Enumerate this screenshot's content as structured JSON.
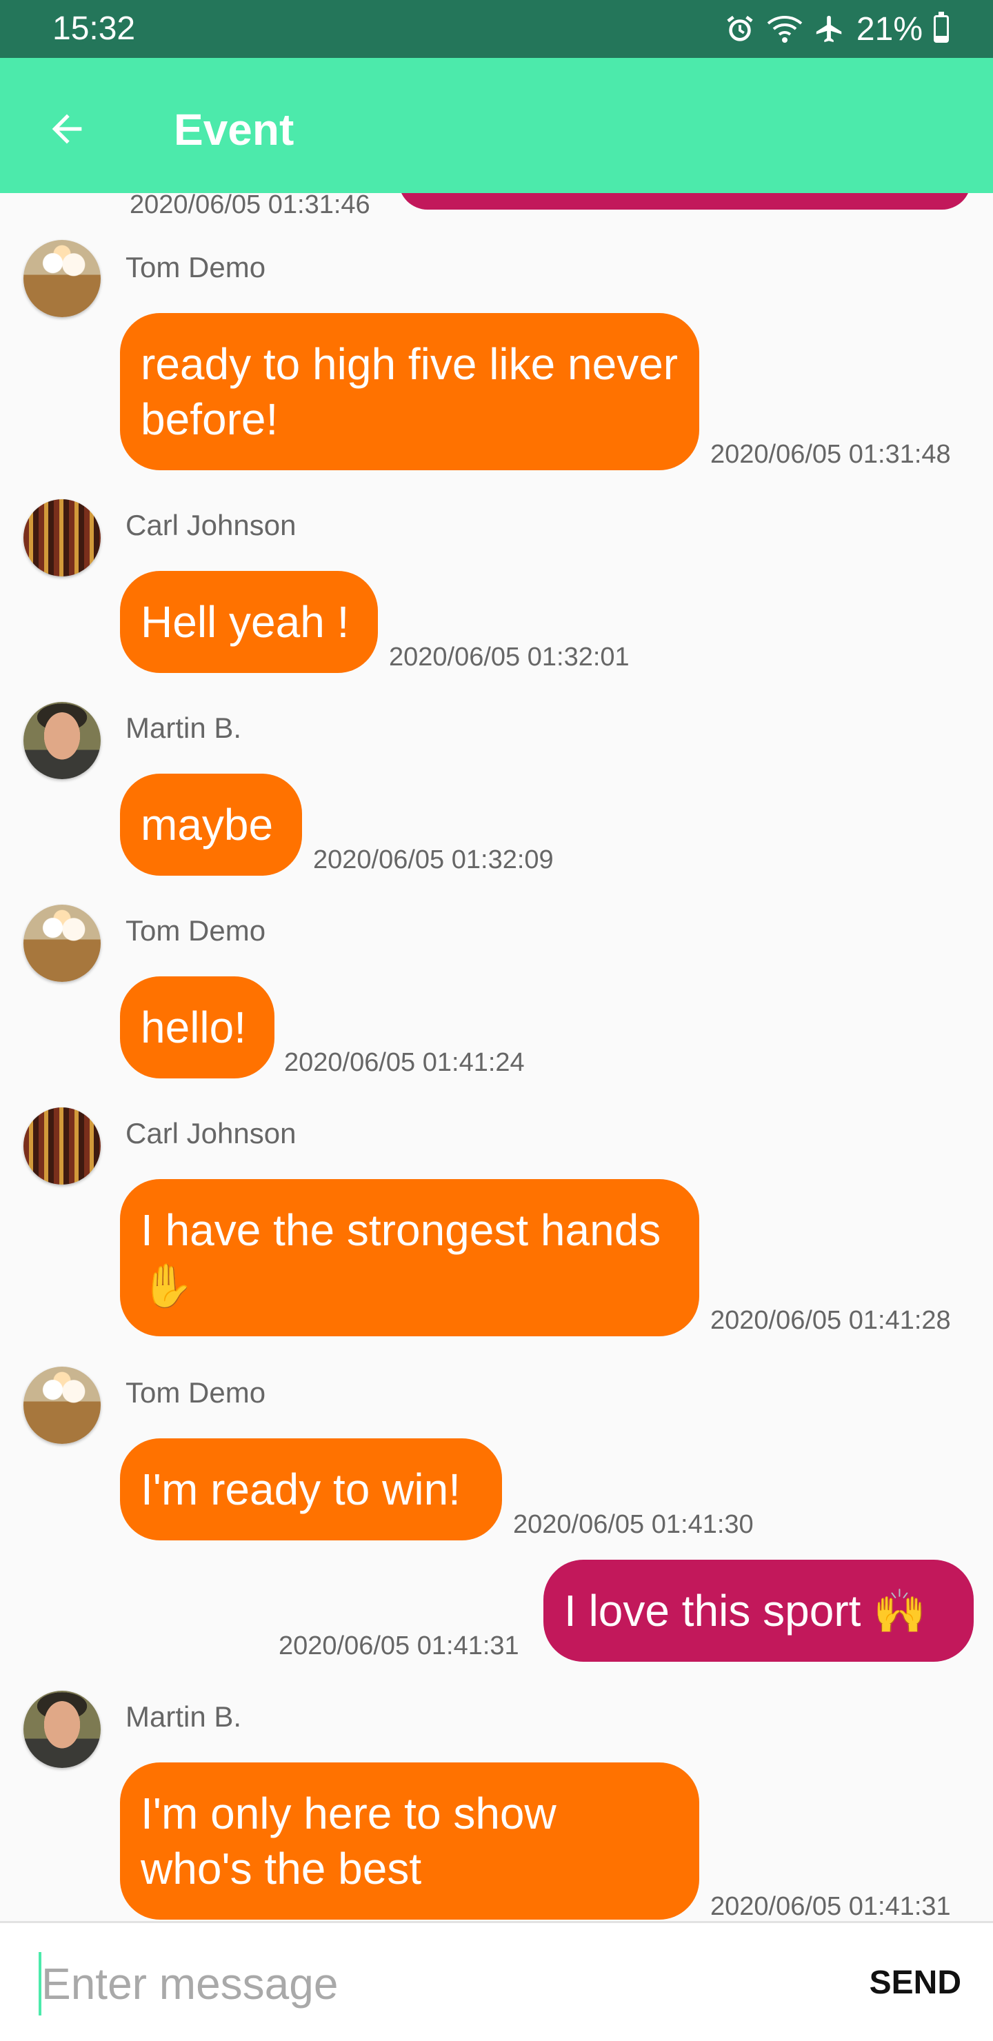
{
  "status_bar": {
    "time": "15:32",
    "battery": "21%",
    "battery_level": 0.21,
    "icons": [
      "alarm-icon",
      "wifi-icon",
      "airplane-icon",
      "battery-icon"
    ]
  },
  "app_bar": {
    "title": "Event",
    "back_icon": "arrow-left-icon",
    "color": "#4ceaab"
  },
  "colors": {
    "status_bar": "#24765a",
    "incoming_bubble": "#ff7200",
    "outgoing_bubble": "#c2185b"
  },
  "messages": [
    {
      "stamp": "2020/06/05 01:31:46",
      "own": true
    },
    {
      "sender": "Tom Demo",
      "text": "ready to high five like never before!",
      "stamp": "2020/06/05 01:31:48",
      "avatar": "cupcake"
    },
    {
      "sender": "Carl Johnson",
      "text": "Hell yeah !",
      "stamp": "2020/06/05 01:32:01",
      "avatar": "bar"
    },
    {
      "sender": "Martin B.",
      "text": "maybe",
      "stamp": "2020/06/05 01:32:09",
      "avatar": "man"
    },
    {
      "sender": "Tom Demo",
      "text": "hello!",
      "stamp": "2020/06/05 01:41:24",
      "avatar": "cupcake"
    },
    {
      "sender": "Carl Johnson",
      "text": "I have the strongest hands",
      "emoji": "✋",
      "stamp": "2020/06/05 01:41:28",
      "avatar": "bar"
    },
    {
      "sender": "Tom Demo",
      "text": "I'm ready to win!",
      "stamp": "2020/06/05 01:41:30",
      "avatar": "cupcake"
    },
    {
      "text": "I love this sport",
      "emoji": "🙌",
      "stamp": "2020/06/05 01:41:31",
      "own": true
    },
    {
      "sender": "Martin B.",
      "text": "I'm only here to show who's the best",
      "stamp": "2020/06/05 01:41:31",
      "avatar": "man"
    }
  ],
  "input": {
    "placeholder": "Enter message",
    "value": "",
    "send_label": "SEND"
  }
}
